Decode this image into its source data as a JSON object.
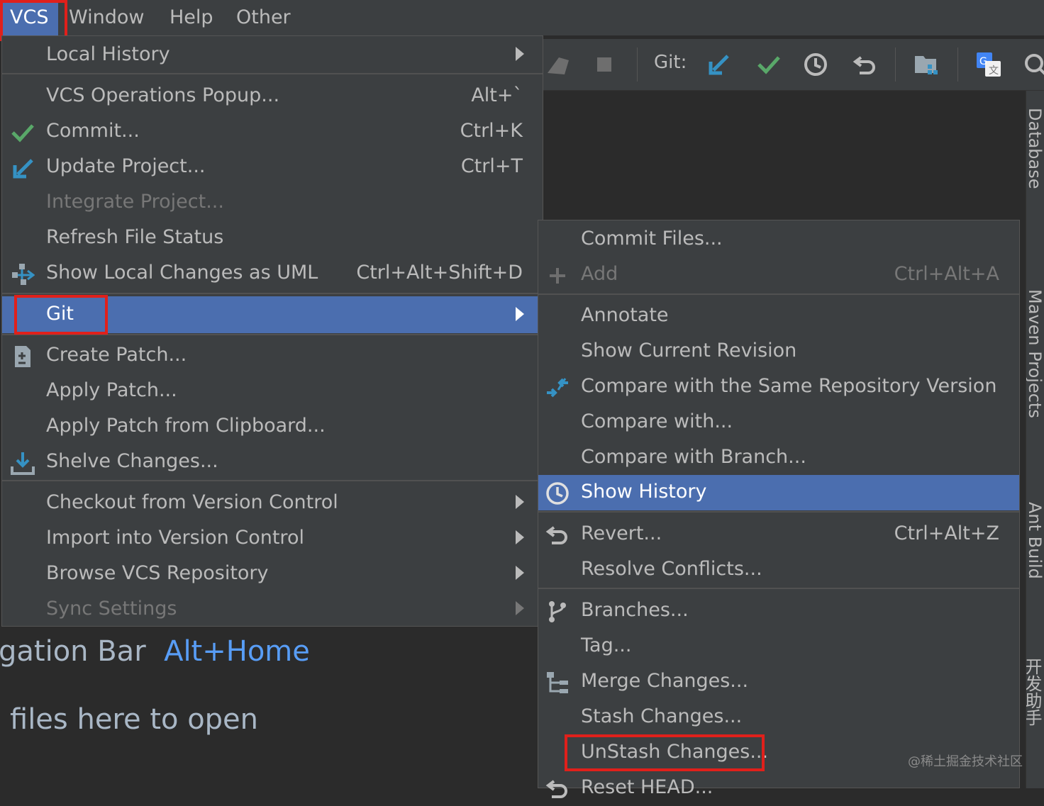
{
  "menubar": {
    "vcs": "VCS",
    "window": "Window",
    "help": "Help",
    "other": "Other"
  },
  "toolbar": {
    "git_label": "Git:",
    "icons": [
      "stop-icon",
      "update-arrow-icon",
      "commit-check-icon",
      "history-clock-icon",
      "revert-icon",
      "project-structure-icon",
      "translate-icon",
      "search-icon"
    ]
  },
  "right_tabs": {
    "database": "Database",
    "maven": "Maven Projects",
    "ant": "Ant Build",
    "dev": "开发助手"
  },
  "background": {
    "nav_bar_text": "gation Bar",
    "nav_bar_shortcut": "Alt+Home",
    "drop_files": "files here to open"
  },
  "vcs_menu": {
    "local_history": "Local History",
    "vcs_operations_popup": "VCS Operations Popup...",
    "vcs_operations_popup_sc": "Alt+`",
    "commit": "Commit...",
    "commit_sc": "Ctrl+K",
    "update_project": "Update Project...",
    "update_project_sc": "Ctrl+T",
    "integrate_project": "Integrate Project...",
    "refresh_file_status": "Refresh File Status",
    "show_local_changes_uml": "Show Local Changes as UML",
    "show_local_changes_uml_sc": "Ctrl+Alt+Shift+D",
    "git": "Git",
    "create_patch": "Create Patch...",
    "apply_patch": "Apply Patch...",
    "apply_patch_clipboard": "Apply Patch from Clipboard...",
    "shelve_changes": "Shelve Changes...",
    "checkout_vc": "Checkout from Version Control",
    "import_vc": "Import into Version Control",
    "browse_vcs": "Browse VCS Repository",
    "sync_settings": "Sync Settings"
  },
  "git_menu": {
    "commit_files": "Commit Files...",
    "add": "Add",
    "add_sc": "Ctrl+Alt+A",
    "annotate": "Annotate",
    "show_current_revision": "Show Current Revision",
    "compare_same_repo": "Compare with the Same Repository Version",
    "compare_with": "Compare with...",
    "compare_branch": "Compare with Branch...",
    "show_history": "Show History",
    "revert": "Revert...",
    "revert_sc": "Ctrl+Alt+Z",
    "resolve_conflicts": "Resolve Conflicts...",
    "branches": "Branches...",
    "tag": "Tag...",
    "merge_changes": "Merge Changes...",
    "stash_changes": "Stash Changes...",
    "unstash_changes": "UnStash Changes...",
    "reset_head": "Reset HEAD..."
  },
  "watermark": "@稀土掘金技术社区",
  "colors": {
    "selection": "#4b6eaf",
    "highlight_box": "#e0201b",
    "menu_bg": "#3c3f41",
    "accent_blue": "#589df6",
    "check_green": "#59a869"
  }
}
